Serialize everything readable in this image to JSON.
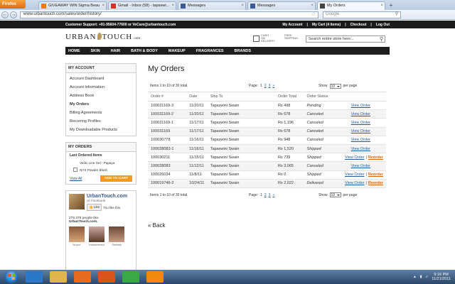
{
  "browser": {
    "menu_button": "Firefox",
    "tabs": [
      {
        "label": "GIVEAWAY WIN Sigma Beau...",
        "icon": "blogger-icon",
        "color": "#f57c00",
        "active": false
      },
      {
        "label": "Gmail - Inbox (58) - tapaswi...",
        "icon": "gmail-icon",
        "color": "#d93025",
        "active": false
      },
      {
        "label": "Messages",
        "icon": "facebook-icon",
        "color": "#3b5998",
        "active": false
      },
      {
        "label": "Messages",
        "icon": "facebook-icon",
        "color": "#3b5998",
        "active": false
      },
      {
        "label": "My Orders",
        "icon": "urbantouch-icon",
        "color": "#444444",
        "active": true
      }
    ],
    "url": "www.urbantouch.com/sales/order/history/",
    "search_placeholder": "Google"
  },
  "site": {
    "support_text": "Customer Support: +91-95604-77600 or VeCare@urbantouch.com",
    "top_links": [
      "My Account",
      "My Cart (4 items)",
      "Checkout",
      "Log Out"
    ],
    "logo": {
      "left": "URBAN",
      "right": "TOUCH",
      "suffix": ".com"
    },
    "cod_label": "CASH ON DELIVERY",
    "free_shipping_label": "FREE SHIPPING",
    "search_placeholder": "Search entire store here...",
    "nav": [
      "HOME",
      "SKIN",
      "HAIR",
      "BATH & BODY",
      "MAKEUP",
      "FRAGRANCES",
      "BRANDS"
    ]
  },
  "sidebar": {
    "account_title": "MY ACCOUNT",
    "account_items": [
      "Account Dashboard",
      "Account Information",
      "Address Book",
      "My Orders",
      "Billing Agreements",
      "Recurring Profiles",
      "My Downloadable Products"
    ],
    "current_item": "My Orders",
    "orders_title": "MY ORDERS",
    "last_ordered_label": "Last Ordered Items",
    "last_ordered": [
      "Vedic Line Gel - Papaya",
      "NYX Powder Blush"
    ],
    "view_all": "View All",
    "add_to_cart": "ADD TO CART",
    "facebook": {
      "name": "UrbanTouch.com",
      "sub": "on Facebook",
      "like_button": "Like",
      "like_text": "You like this.",
      "likes_count": "276,378 people like",
      "likes_page": "UrbanTouch.com.",
      "fans": [
        "Nupur",
        "Indiatvbeaut",
        "Shrilata"
      ]
    }
  },
  "main": {
    "title": "My Orders",
    "items_text": "Items 1 to 10 of 30 total",
    "page_label": "Page:",
    "pages": [
      "1",
      "2",
      "3"
    ],
    "next_icon": "»",
    "show_label": "Show",
    "per_page_value": "10",
    "per_page_label": "per page",
    "columns": [
      "Order #",
      "Date",
      "Ship To",
      "Order Total",
      "Order Status",
      ""
    ],
    "view_order": "View Order",
    "reorder": "Reorder",
    "orders": [
      {
        "num": "100031169-3",
        "date": "11/20/11",
        "ship_to": "Tapaswini Swain",
        "total": "Rs 498",
        "status": "Pending",
        "reorder": false
      },
      {
        "num": "100031169-2",
        "date": "11/20/11",
        "ship_to": "Tapaswini Swain",
        "total": "Rs 678",
        "status": "Canceled",
        "reorder": false
      },
      {
        "num": "100031169-1",
        "date": "11/17/11",
        "ship_to": "Tapaswini Swain",
        "total": "Rs 1,196",
        "status": "Canceled",
        "reorder": false
      },
      {
        "num": "100031169",
        "date": "11/17/11",
        "ship_to": "Tapaswini Swain",
        "total": "Rs 678",
        "status": "Canceled",
        "reorder": false
      },
      {
        "num": "100030778",
        "date": "11/16/11",
        "ship_to": "Tapaswini Swain",
        "total": "Rs 948",
        "status": "Canceled",
        "reorder": false
      },
      {
        "num": "100028083-1",
        "date": "11/16/11",
        "ship_to": "Tapaswini Swain",
        "total": "Rs 1,520",
        "status": "Shipped",
        "reorder": false
      },
      {
        "num": "100030211",
        "date": "11/15/11",
        "ship_to": "Tapaswini Swain",
        "total": "Rs 739",
        "status": "Shipped",
        "reorder": true
      },
      {
        "num": "100028083",
        "date": "11/12/11",
        "ship_to": "Tapaswini Swain",
        "total": "Rs 3,065",
        "status": "Canceled",
        "reorder": false
      },
      {
        "num": "100026034",
        "date": "11/8/11",
        "ship_to": "Tapaswini Swain",
        "total": "Rs 0",
        "status": "Shipped",
        "reorder": true
      },
      {
        "num": "100019746-2",
        "date": "10/24/11",
        "ship_to": "Tapaswini Swain",
        "total": "Rs 2,022",
        "status": "Delivered",
        "reorder": true
      }
    ],
    "back": "« Back"
  },
  "taskbar": {
    "apps": [
      {
        "name": "ie-icon",
        "color": "#2b78c9"
      },
      {
        "name": "folder-icon",
        "color": "#e0b64a"
      },
      {
        "name": "media-player-icon",
        "color": "#e86a1c"
      },
      {
        "name": "firefox-icon",
        "color": "#d9541a"
      },
      {
        "name": "download-icon",
        "color": "#3aa845"
      },
      {
        "name": "vlc-icon",
        "color": "#f08a0c"
      }
    ],
    "time": "9:16 PM",
    "date": "11/21/2011"
  }
}
